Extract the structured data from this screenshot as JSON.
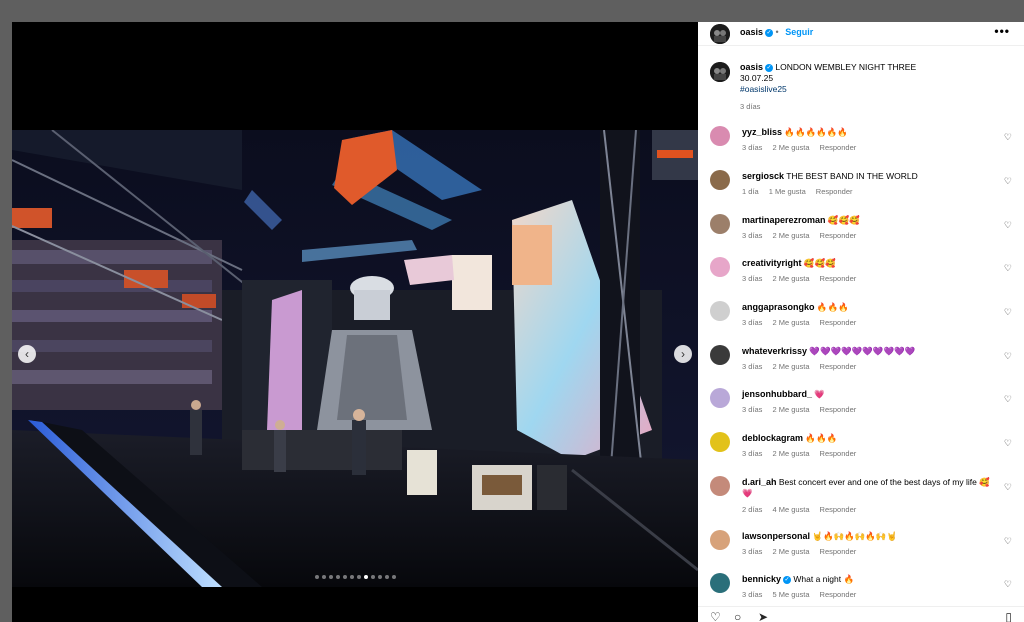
{
  "post": {
    "author": "oasis",
    "follow_label": "Seguir",
    "more_label": "•••",
    "caption_line1": "LONDON WEMBLEY NIGHT THREE",
    "caption_line2": "30.07.25",
    "hashtag": "#oasislive25",
    "time": "3 días"
  },
  "carousel": {
    "prev_icon": "‹",
    "next_icon": "›",
    "slide_count": 12,
    "active_slide": 7
  },
  "comments": [
    {
      "user": "yyz_bliss",
      "text": "🔥🔥🔥🔥🔥🔥",
      "time": "3 días",
      "likes": "2 Me gusta",
      "reply": "Responder",
      "verified": false,
      "avatar_color": "#d98bb0"
    },
    {
      "user": "sergiosck",
      "text": "THE BEST BAND IN THE WORLD",
      "time": "1 día",
      "likes": "1 Me gusta",
      "reply": "Responder",
      "verified": false,
      "avatar_color": "#8a6a4a"
    },
    {
      "user": "martinaperezroman",
      "text": "🥰🥰🥰",
      "time": "3 días",
      "likes": "2 Me gusta",
      "reply": "Responder",
      "verified": false,
      "avatar_color": "#9c7f6a"
    },
    {
      "user": "creativityright",
      "text": "🥰🥰🥰",
      "time": "3 días",
      "likes": "2 Me gusta",
      "reply": "Responder",
      "verified": false,
      "avatar_color": "#e7a6c9"
    },
    {
      "user": "anggaprasongko",
      "text": "🔥🔥🔥",
      "time": "3 días",
      "likes": "2 Me gusta",
      "reply": "Responder",
      "verified": false,
      "avatar_color": "#cfcfcf"
    },
    {
      "user": "whateverkrissy",
      "text": "💜💜💜💜💜💜💜💜💜💜",
      "time": "3 días",
      "likes": "2 Me gusta",
      "reply": "Responder",
      "verified": false,
      "avatar_color": "#3a3a3a"
    },
    {
      "user": "jensonhubbard_",
      "text": "💗",
      "time": "3 días",
      "likes": "2 Me gusta",
      "reply": "Responder",
      "verified": false,
      "avatar_color": "#b9a8d8"
    },
    {
      "user": "deblockagram",
      "text": "🔥🔥🔥",
      "time": "3 días",
      "likes": "2 Me gusta",
      "reply": "Responder",
      "verified": false,
      "avatar_color": "#e2c21a"
    },
    {
      "user": "d.ari_ah",
      "text": "Best concert ever and one of the best days of my life 🥰💗",
      "time": "2 días",
      "likes": "4 Me gusta",
      "reply": "Responder",
      "verified": false,
      "avatar_color": "#c48a7a"
    },
    {
      "user": "lawsonpersonal",
      "text": "🤘🔥🙌🔥🙌🔥🙌🤘",
      "time": "3 días",
      "likes": "2 Me gusta",
      "reply": "Responder",
      "verified": false,
      "avatar_color": "#d7a27a"
    },
    {
      "user": "bennicky",
      "text": "What a night 🔥",
      "time": "3 días",
      "likes": "5 Me gusta",
      "reply": "Responder",
      "verified": true,
      "avatar_color": "#2a6f7a"
    }
  ],
  "actions": {
    "like_icon": "♡",
    "comment_icon": "○",
    "share_icon": "➤",
    "save_icon": "▯"
  },
  "icons": {
    "verified_icon": "✓",
    "heart_icon": "♡"
  }
}
